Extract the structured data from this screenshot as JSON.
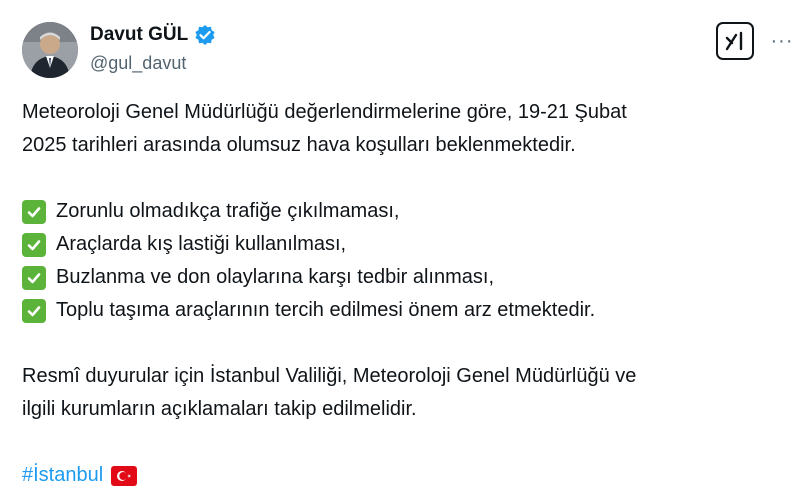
{
  "author": {
    "display_name": "Davut GÜL",
    "handle": "@gul_davut",
    "verified": true,
    "avatar_icon": "profile-photo"
  },
  "actions": {
    "grok_icon": "grok-icon",
    "more_label": "···"
  },
  "tweet": {
    "intro_line1": "Meteoroloji Genel Müdürlüğü değerlendirmelerine göre, 19-21 Şubat",
    "intro_line2": "2025 tarihleri arasında olumsuz hava koşulları beklenmektedir.",
    "checklist": [
      "Zorunlu olmadıkça trafiğe çıkılmaması,",
      "Araçlarda kış lastiği kullanılması,",
      "Buzlanma ve don olaylarına karşı tedbir alınması,",
      "Toplu taşıma araçlarının tercih edilmesi önem arz etmektedir."
    ],
    "outro_line1": "Resmî duyurular için İstanbul Valiliği, Meteoroloji Genel Müdürlüğü ve",
    "outro_line2": "ilgili kurumların açıklamaları takip edilmelidir.",
    "hashtag": "#İstanbul",
    "flag_icon": "turkey-flag-icon"
  },
  "colors": {
    "text": "#0f1419",
    "secondary_text": "#536471",
    "link": "#1d9bf0",
    "verified_badge": "#1d9bf0",
    "check_green": "#5cb33a",
    "flag_red": "#e30a17"
  }
}
